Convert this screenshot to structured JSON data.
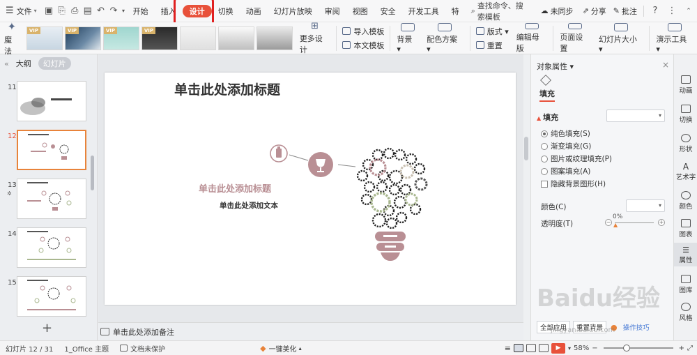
{
  "menubar": {
    "file_label": "文件",
    "tabs": [
      {
        "label": "开始",
        "active": false
      },
      {
        "label": "插入",
        "active": false
      },
      {
        "label": "设计",
        "active": true
      },
      {
        "label": "切换",
        "active": false
      },
      {
        "label": "动画",
        "active": false
      },
      {
        "label": "幻灯片放映",
        "active": false
      },
      {
        "label": "审阅",
        "active": false
      },
      {
        "label": "视图",
        "active": false
      },
      {
        "label": "安全",
        "active": false
      },
      {
        "label": "开发工具",
        "active": false
      },
      {
        "label": "特",
        "active": false
      }
    ],
    "search_label": "查找命令、搜索模板",
    "sync_label": "未同步",
    "share_label": "分享",
    "comment_label": "批注",
    "accent": "#e8513a"
  },
  "ribbon": {
    "magic_label": "魔法",
    "vip_badge": "VIP",
    "more_design_label": "更多设计",
    "import_template_label": "导入模板",
    "local_template_label": "本文模板",
    "background_label": "背景",
    "color_scheme_label": "配色方案",
    "layout_label": "版式",
    "reset_label": "重置",
    "edit_master_label": "编辑母版",
    "page_setup_label": "页面设置",
    "slide_size_label": "幻灯片大小",
    "presentation_tools_label": "演示工具"
  },
  "leftpanel": {
    "outline_label": "大纲",
    "slides_label": "幻灯片",
    "slides": [
      {
        "num": "11",
        "active": false
      },
      {
        "num": "12",
        "active": true
      },
      {
        "num": "13",
        "active": false
      },
      {
        "num": "14",
        "active": false
      },
      {
        "num": "15",
        "active": false
      }
    ],
    "add_label": "+"
  },
  "slide": {
    "title": "单击此处添加标题",
    "subtitle": "单击此处添加标题",
    "text": "单击此处添加文本",
    "accent_pink": "#b98f94",
    "accent_green": "#a9b78f"
  },
  "notes": {
    "placeholder": "单击此处添加备注"
  },
  "rightpanel": {
    "title": "对象属性",
    "fill_tab": "填充",
    "fill_section": "填充",
    "options": [
      {
        "label": "纯色填充(S)",
        "type": "radio",
        "checked": true
      },
      {
        "label": "渐变填充(G)",
        "type": "radio",
        "checked": false
      },
      {
        "label": "图片或纹理填充(P)",
        "type": "radio",
        "checked": false
      },
      {
        "label": "图案填充(A)",
        "type": "radio",
        "checked": false
      },
      {
        "label": "隐藏背景图形(H)",
        "type": "checkbox",
        "checked": false
      }
    ],
    "color_label": "颜色(C)",
    "transparency_label": "透明度(T)",
    "transparency_value": "0%",
    "apply_all_label": "全部应用",
    "reset_bg_label": "重置背景",
    "tips_label": "操作技巧"
  },
  "righttoolbar": {
    "items": [
      {
        "label": "动画",
        "active": false
      },
      {
        "label": "切换",
        "active": false
      },
      {
        "label": "形状",
        "active": false
      },
      {
        "label": "艺术字",
        "active": false
      },
      {
        "label": "颜色",
        "active": false
      },
      {
        "label": "图表",
        "active": false
      },
      {
        "label": "属性",
        "active": true
      },
      {
        "label": "图库",
        "active": false
      },
      {
        "label": "风格",
        "active": false
      }
    ]
  },
  "statusbar": {
    "slide_info": "幻灯片 12 / 31",
    "theme": "1_Office 主题",
    "protect": "文档未保护",
    "beautify": "一键美化",
    "zoom": "58%"
  },
  "watermark": {
    "text": "Baidu经验",
    "url": "jingyan.baidu.com"
  }
}
